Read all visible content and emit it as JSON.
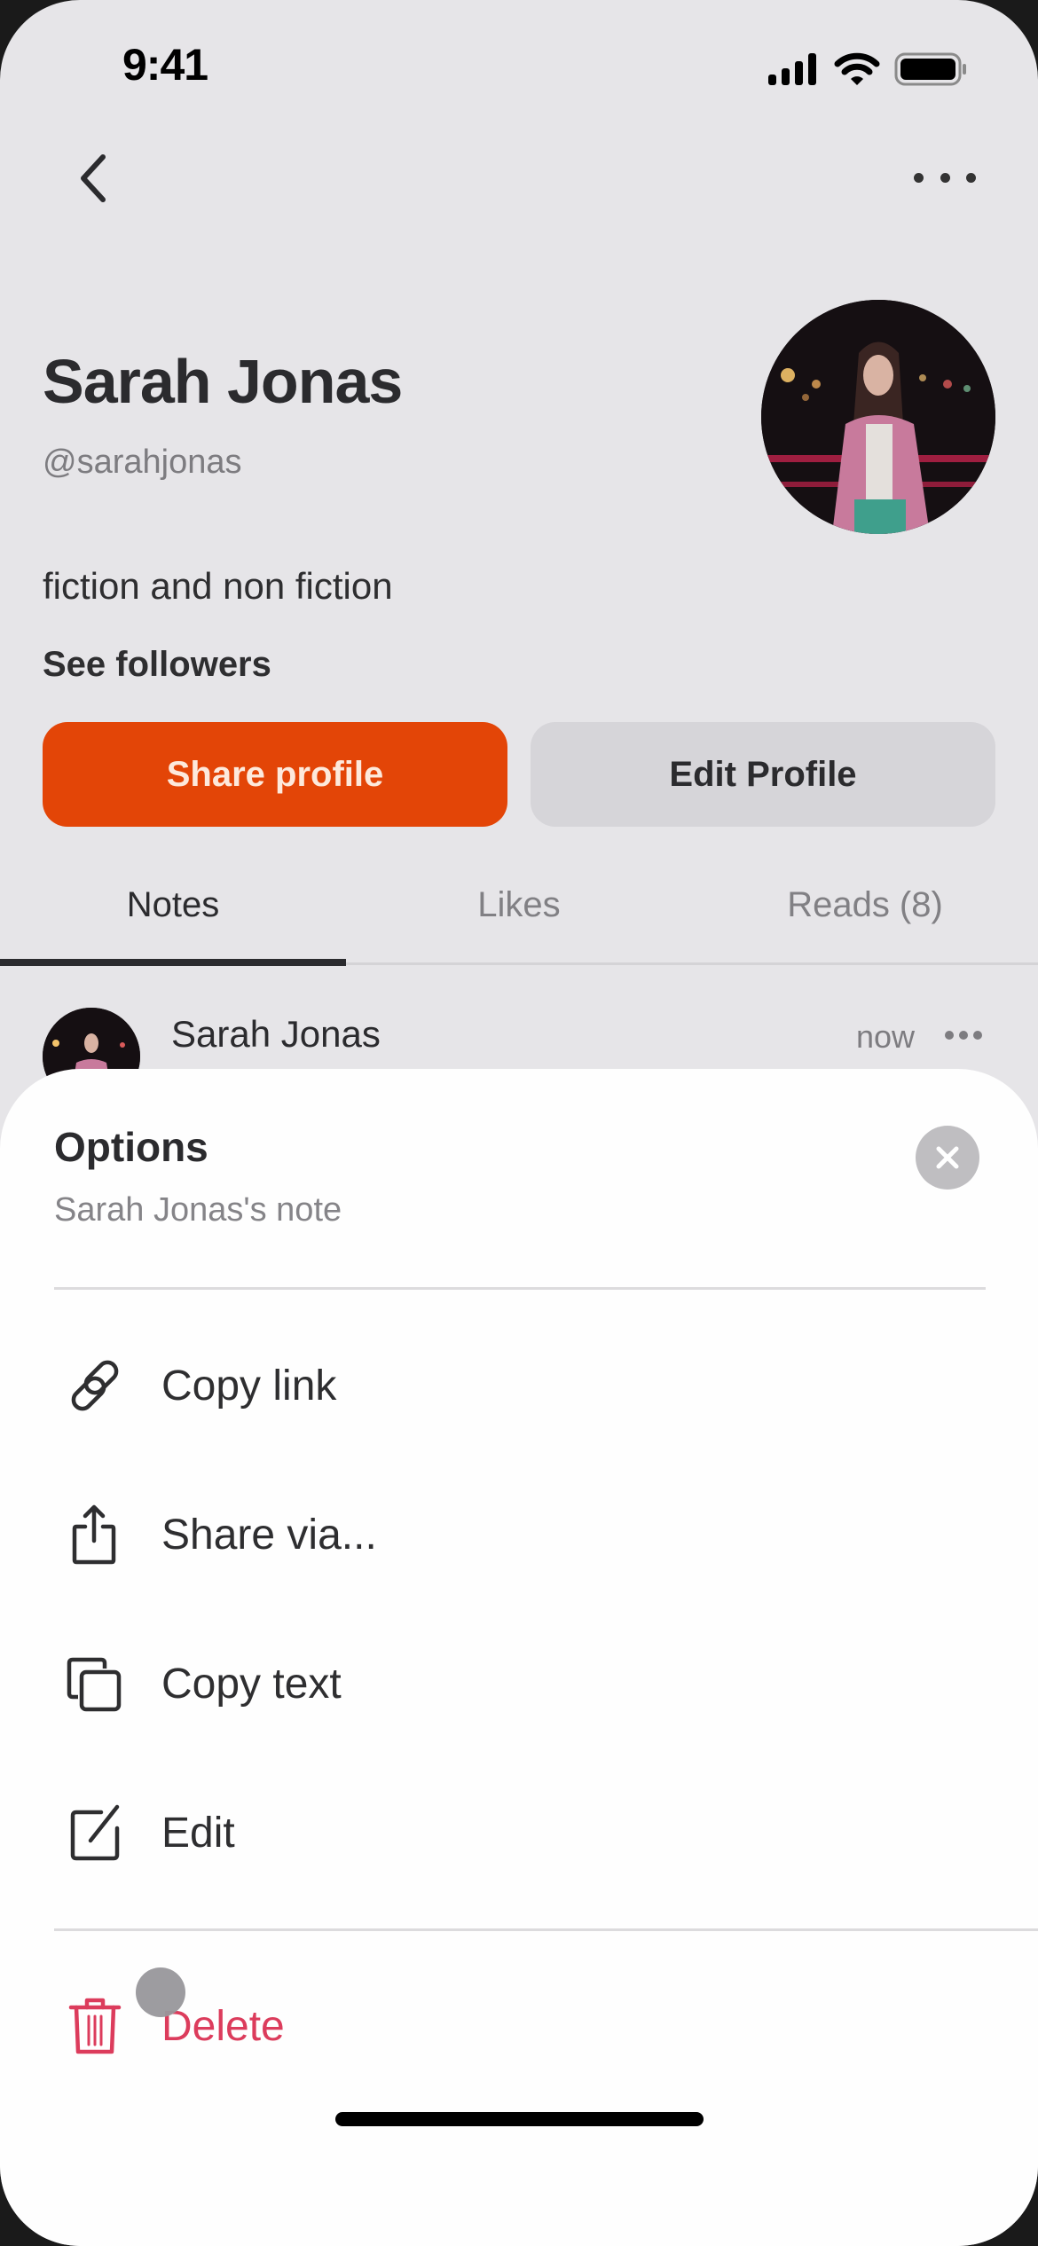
{
  "status_bar": {
    "time": "9:41"
  },
  "nav": {
    "back_icon": "chevron-left-icon",
    "more_icon": "ellipsis-icon"
  },
  "profile": {
    "name": "Sarah Jonas",
    "handle": "@sarahjonas",
    "bio": "fiction and non fiction",
    "followers_link": "See followers",
    "avatar": "profile-photo"
  },
  "actions": {
    "share_label": "Share profile",
    "edit_label": "Edit Profile"
  },
  "tabs": [
    {
      "label": "Notes",
      "active": true
    },
    {
      "label": "Likes",
      "active": false
    },
    {
      "label": "Reads (8)",
      "active": false
    }
  ],
  "note": {
    "author": "Sarah Jonas",
    "time": "now"
  },
  "sheet": {
    "title": "Options",
    "subtitle": "Sarah Jonas's note",
    "items": [
      {
        "label": "Copy link",
        "icon": "link-icon"
      },
      {
        "label": "Share via...",
        "icon": "share-icon"
      },
      {
        "label": "Copy text",
        "icon": "copy-icon"
      },
      {
        "label": "Edit",
        "icon": "edit-icon"
      }
    ],
    "danger_item": {
      "label": "Delete",
      "icon": "trash-icon"
    }
  },
  "colors": {
    "accent": "#e34507",
    "danger": "#dc3c5c",
    "background": "#e6e5e8",
    "sheet": "#fefefe",
    "text": "#2b2b2e",
    "muted": "#7d7c80"
  }
}
